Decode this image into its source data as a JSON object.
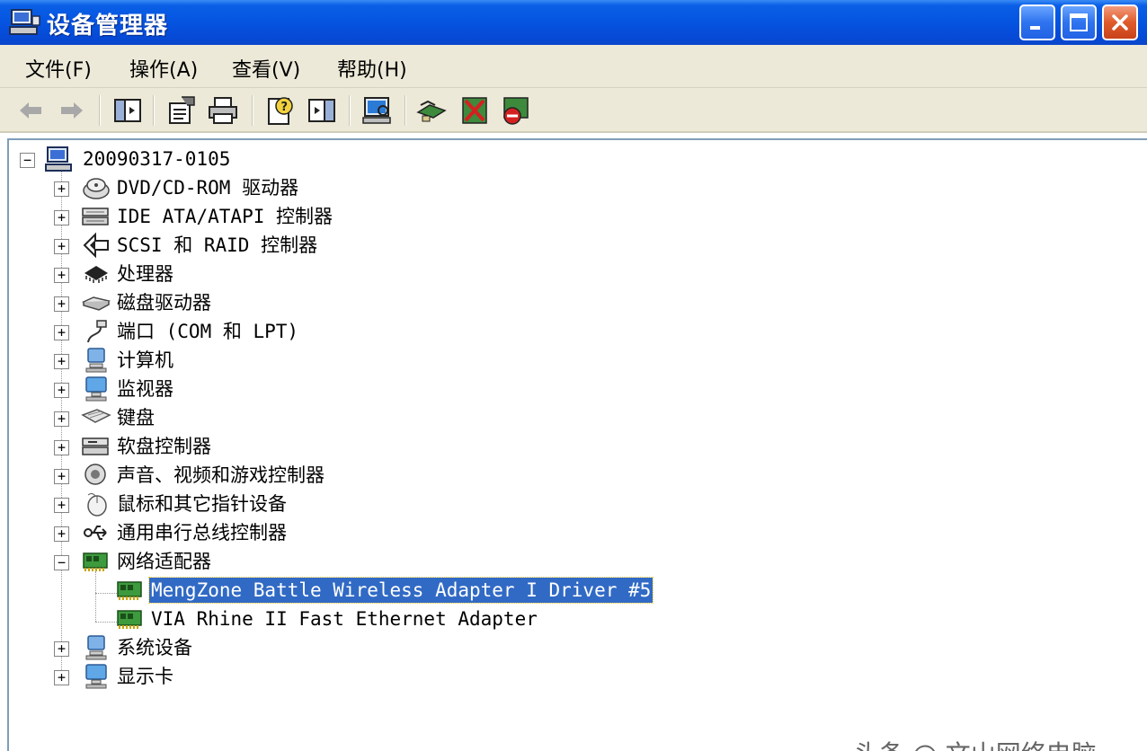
{
  "window": {
    "title": "设备管理器"
  },
  "menu": [
    {
      "label": "文件(F)"
    },
    {
      "label": "操作(A)"
    },
    {
      "label": "查看(V)"
    },
    {
      "label": "帮助(H)"
    }
  ],
  "tree": {
    "root": "20090317-0105",
    "categories": [
      {
        "label": "DVD/CD-ROM 驱动器",
        "icon": "cdrom-icon"
      },
      {
        "label": "IDE ATA/ATAPI 控制器",
        "icon": "ide-controller-icon"
      },
      {
        "label": "SCSI 和 RAID 控制器",
        "icon": "scsi-icon"
      },
      {
        "label": "处理器",
        "icon": "processor-icon"
      },
      {
        "label": "磁盘驱动器",
        "icon": "disk-drive-icon"
      },
      {
        "label": "端口 (COM 和 LPT)",
        "icon": "port-icon"
      },
      {
        "label": "计算机",
        "icon": "computer-icon"
      },
      {
        "label": "监视器",
        "icon": "monitor-icon"
      },
      {
        "label": "键盘",
        "icon": "keyboard-icon"
      },
      {
        "label": "软盘控制器",
        "icon": "floppy-controller-icon"
      },
      {
        "label": "声音、视频和游戏控制器",
        "icon": "sound-icon"
      },
      {
        "label": "鼠标和其它指针设备",
        "icon": "mouse-icon"
      },
      {
        "label": "通用串行总线控制器",
        "icon": "usb-icon"
      },
      {
        "label": "网络适配器",
        "icon": "network-adapter-icon"
      },
      {
        "label": "系统设备",
        "icon": "system-device-icon"
      },
      {
        "label": "显示卡",
        "icon": "display-adapter-icon"
      }
    ],
    "network_children": [
      {
        "label": "MengZone Battle Wireless Adapter I Driver #5",
        "selected": true
      },
      {
        "label": "VIA Rhine II Fast Ethernet Adapter",
        "selected": false
      }
    ]
  },
  "watermark": "头条 @ 文山网络电脑",
  "colors": {
    "selection": "#316ac5",
    "titlebar": "#0554e0",
    "chrome": "#ece9d8"
  }
}
